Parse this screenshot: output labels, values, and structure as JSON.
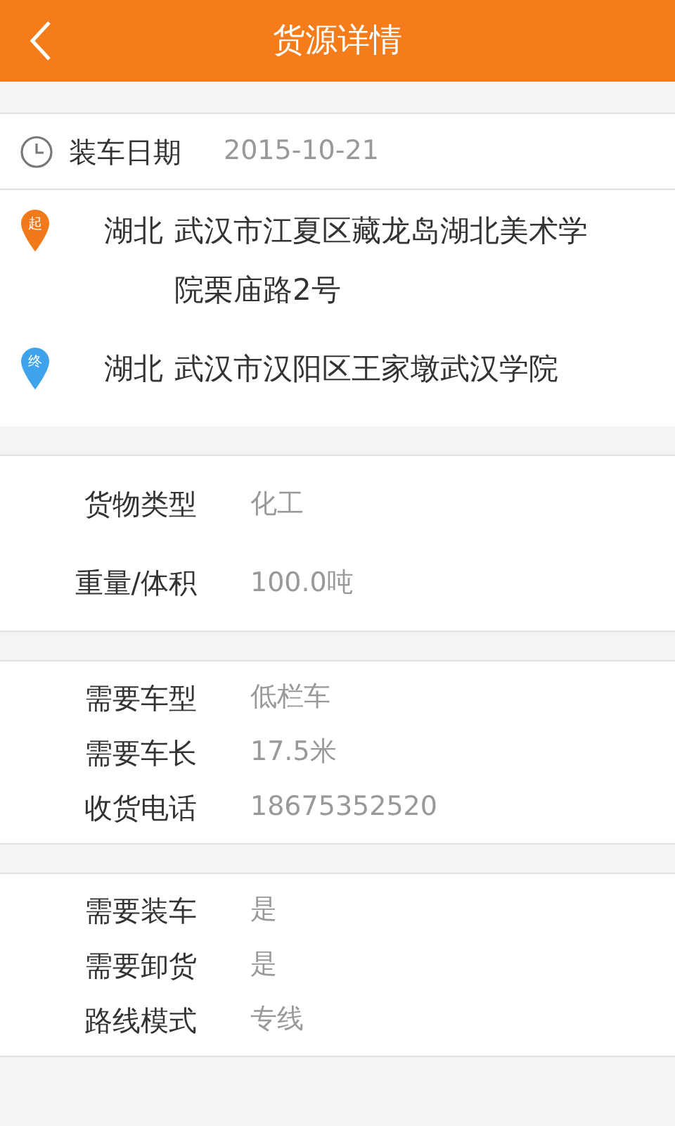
{
  "header": {
    "title": "货源详情"
  },
  "load_date": {
    "label": "装车日期",
    "value": "2015-10-21"
  },
  "route": [
    {
      "badge": "起",
      "color": "#f07a1a",
      "province": "湖北",
      "address": "武汉市江夏区藏龙岛湖北美术学院栗庙路2号"
    },
    {
      "badge": "终",
      "color": "#3fa3ec",
      "province": "湖北",
      "address": "武汉市汉阳区王家墩武汉学院"
    }
  ],
  "sections": [
    {
      "rows": [
        {
          "label": "货物类型",
          "value": "化工"
        },
        {
          "label": "重量/体积",
          "value": "100.0吨"
        }
      ]
    },
    {
      "rows": [
        {
          "label": "需要车型",
          "value": "低栏车"
        },
        {
          "label": "需要车长",
          "value": "17.5米"
        },
        {
          "label": "收货电话",
          "value": "18675352520"
        }
      ]
    },
    {
      "rows": [
        {
          "label": "需要装车",
          "value": "是"
        },
        {
          "label": "需要卸货",
          "value": "是"
        },
        {
          "label": "路线模式",
          "value": "专线"
        }
      ]
    }
  ]
}
